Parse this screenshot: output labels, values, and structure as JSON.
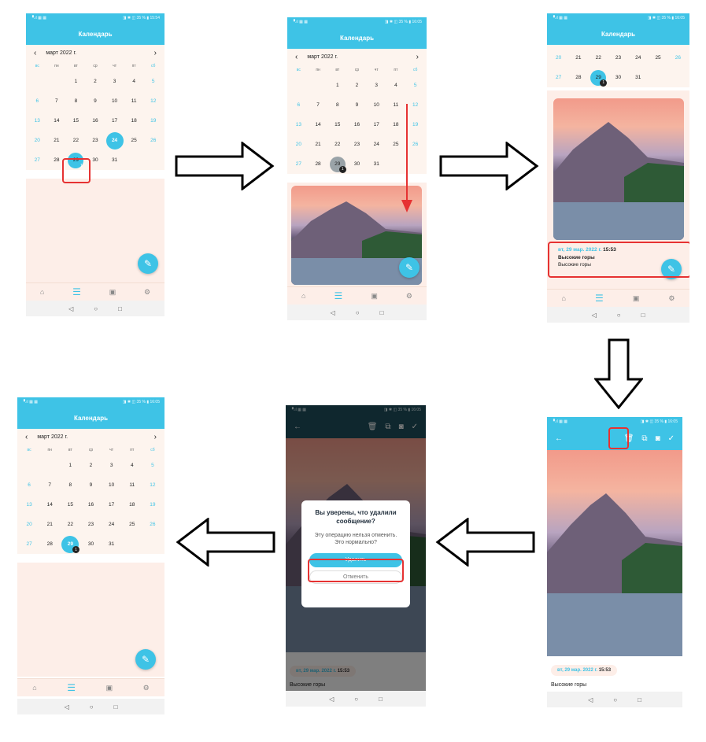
{
  "calendar": {
    "status_right": "◨ ✱ ◫ 35 % ▮ 15:54",
    "title": "Календарь",
    "month": "март 2022 г.",
    "prev": "‹",
    "next": "›",
    "weekdays": [
      "вс",
      "пн",
      "вт",
      "ср",
      "чт",
      "пт",
      "сб"
    ],
    "rows": [
      [
        "",
        "",
        "1",
        "2",
        "3",
        "4",
        "5"
      ],
      [
        "6",
        "7",
        "8",
        "9",
        "10",
        "11",
        "12"
      ],
      [
        "13",
        "14",
        "15",
        "16",
        "17",
        "18",
        "19"
      ],
      [
        "20",
        "21",
        "22",
        "23",
        "24",
        "25",
        "26"
      ],
      [
        "27",
        "28",
        "29",
        "30",
        "31",
        "",
        ""
      ]
    ],
    "badge_count": "1",
    "fab_icon": "✎"
  },
  "screen3": {
    "rows": [
      [
        "20",
        "21",
        "22",
        "23",
        "24",
        "25",
        "26"
      ],
      [
        "27",
        "28",
        "29",
        "30",
        "31",
        "",
        ""
      ]
    ],
    "date_label": "вт, 29 мар. 2022 г.",
    "time": "15:53",
    "title": "Высокие горы",
    "body": "Высокие горы"
  },
  "editor": {
    "back": "←",
    "delete_icon": "🗑",
    "copy_icon": "⧉",
    "camera_icon": "◙",
    "check_icon": "✓",
    "date_label": "вт, 29 мар. 2022 г.",
    "time": "15:53",
    "body": "Высокие горы"
  },
  "dialog": {
    "title": "Вы уверены, что удалили сообщение?",
    "message": "Эту операцию нельзя отменить. Это нормально?",
    "confirm": "Удалить",
    "cancel": "Отменить"
  },
  "nav": {
    "home": "⌂",
    "list": "☰",
    "gallery": "▣",
    "settings": "⚙",
    "back": "◁",
    "homebtn": "○",
    "recent": "□"
  },
  "colors": {
    "accent": "#3ec3e6",
    "highlight": "#e63232",
    "background": "#fdf4ee"
  }
}
